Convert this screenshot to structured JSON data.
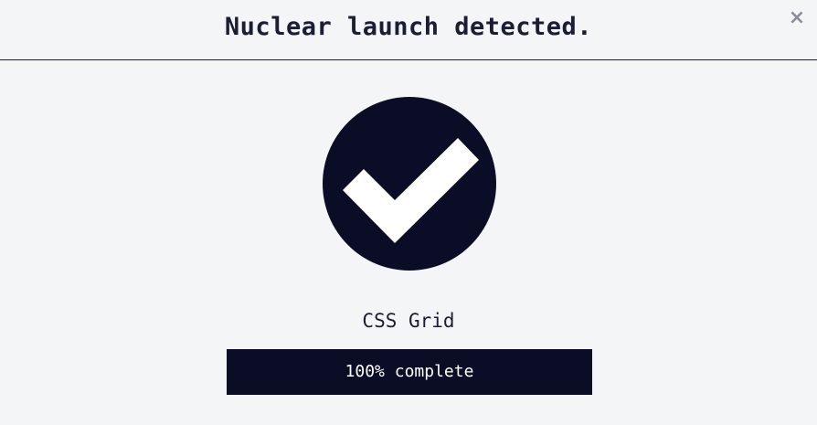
{
  "dialog": {
    "title": "Nuclear launch detected.",
    "close_glyph": "×",
    "status_icon": "checkmark-icon",
    "item_name": "CSS Grid",
    "progress": {
      "percent": 100,
      "label": "100% complete"
    }
  },
  "colors": {
    "background": "#f4f5f7",
    "accent": "#0b0d26",
    "text": "#1a1d33",
    "close": "#8a8d98"
  }
}
